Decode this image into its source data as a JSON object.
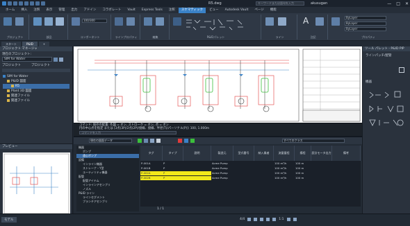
{
  "titlebar": {
    "title": "R5.dwg",
    "search_placeholder": "キーワードまたは語句を入力",
    "user": "akusugan",
    "window_controls": [
      "—",
      "□",
      "✕"
    ]
  },
  "ribbon_tabs": [
    "ホーム",
    "挿入",
    "注釈",
    "表示",
    "管理",
    "出力",
    "アドイン",
    "コラボレート",
    "Vault",
    "Express Tools",
    "注釈",
    "スケマティック",
    "ビュー",
    "Autodesk Vault",
    "ページ",
    "機能"
  ],
  "ribbon_active_tab": 11,
  "ribbon_groups": [
    "プロジェクト",
    "部品",
    "コンポーネント",
    "ラインプロパティ",
    "編集",
    "P&IDパレット",
    "ライン",
    "プロパティ",
    "注記",
    "表示",
    "スタイル"
  ],
  "ribbon_labels": {
    "project": "プロジェクト",
    "line_name": "100/300",
    "line_size": "ByLayer",
    "line_type": "ByLayer",
    "layer": "ByLayer"
  },
  "doc_tabs": [
    "スタート",
    "P&ID",
    "+"
  ],
  "project_manager": {
    "header": "プロジェクト マネージャ",
    "current_project_label": "現在のプロジェクト:",
    "project_combo": "SIM for Water",
    "project_label": "プロジェクト",
    "project_combo2": "プロジェクト",
    "tree": [
      {
        "label": "SIM for Water",
        "level": 0
      },
      {
        "label": "P&ID 図面",
        "level": 1
      },
      {
        "label": "R5",
        "level": 2,
        "selected": true
      },
      {
        "label": "Plant 3D 図面",
        "level": 1
      },
      {
        "label": "関連ファイル",
        "level": 1
      },
      {
        "label": "関連ファイル",
        "level": 1
      }
    ]
  },
  "preview": {
    "header": "プレビュー"
  },
  "tool_palette": {
    "header": "ツール パレット - P&ID PIP",
    "sections": [
      "ラインパッチ/配管",
      "機器",
      "バルブ",
      "計器",
      "サンプル"
    ]
  },
  "command_line": {
    "lines": [
      "コマンド: 既存の配置: 作図 = オン, ストローク = オン, 点 =  オン",
      "円の中心点を指定 または [3点(3P)/2点(2P)/接線、接線、半径(T)/パーソナル(P)]: 100, 1.000m"
    ],
    "input_placeholder": "コマンドを入力"
  },
  "data_manager": {
    "toolbar_combo": "現在の図面データ",
    "toolbar_combo2": "すべてのクラス",
    "tree": [
      "機器",
      "ポンプ",
      "遠心ポンプ",
      "設備",
      "インライン機器",
      "ストレーナ・Y型",
      "ユーティリティ機器",
      "配管",
      "配管アイテム",
      "インラインアセンブリ",
      "ノズル",
      "P&ID ライン",
      "ラインセグメント",
      "ブランチアセンブリ"
    ],
    "tree_selected": 2,
    "columns": [
      "タグ",
      "タイプ",
      "説明",
      "製造元",
      "型式番号",
      "納入業者",
      "流量量程",
      "揚程",
      "設計モータ出力",
      "備考"
    ],
    "rows": [
      [
        "P-001A",
        "P",
        "",
        "Acme Pump",
        "",
        "",
        "100 m³/h",
        "100 m",
        "",
        ""
      ],
      [
        "P-001B",
        "P",
        "",
        "Acme Pump",
        "",
        "",
        "100 m³/h",
        "100 m",
        "",
        ""
      ],
      [
        "P-002A",
        "P",
        "",
        "Acme Pump",
        "",
        "",
        "100 m³/h",
        "100 m",
        "",
        ""
      ],
      [
        "P-002B",
        "P",
        "",
        "Acme Pump",
        "",
        "",
        "100 m³/h",
        "100 m",
        "",
        ""
      ]
    ],
    "highlight_rows": [
      2,
      3
    ],
    "pager": "1 / 1"
  },
  "statusbar": {
    "left_label": "モデル",
    "coords": "4/4",
    "zoom": "1:1"
  },
  "colors": {
    "accent": "#3a82c8",
    "highlight": "#f2e81a",
    "equipment_green": "#3bbf3b",
    "pipe_red": "#e23b3b"
  }
}
